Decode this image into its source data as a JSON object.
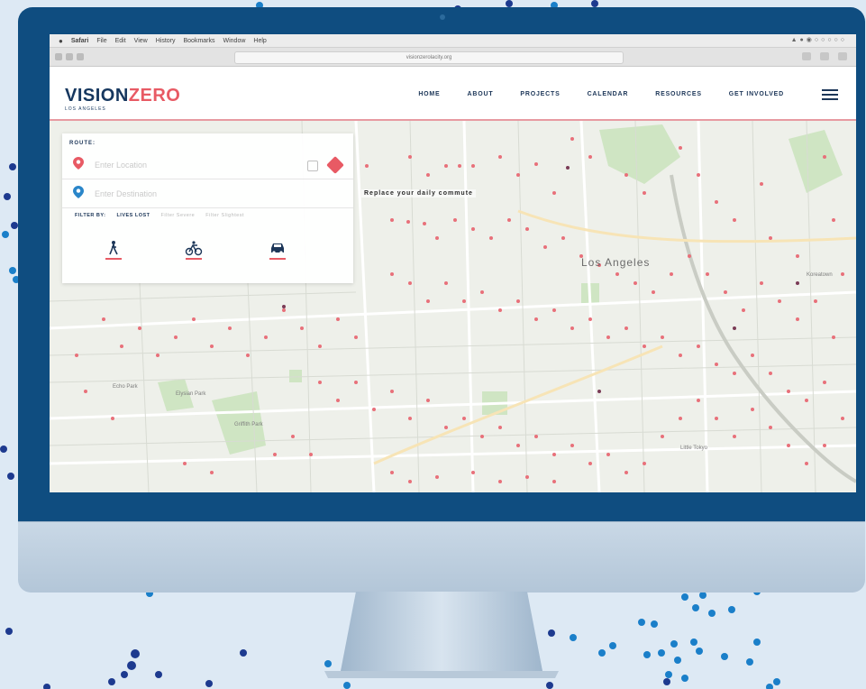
{
  "menubar": {
    "apple": "",
    "items": [
      "Safari",
      "File",
      "Edit",
      "View",
      "History",
      "Bookmarks",
      "Window",
      "Help"
    ]
  },
  "browser": {
    "url": "visionzerolacity.org"
  },
  "site": {
    "logo_vision": "VISION",
    "logo_zero": "ZERO",
    "logo_subtitle": "LOS ANGELES",
    "nav": [
      "HOME",
      "ABOUT",
      "PROJECTS",
      "CALENDAR",
      "RESOURCES",
      "GET INVOLVED"
    ],
    "accent_color": "#e85a64",
    "brand_color": "#16375f"
  },
  "route_panel": {
    "label": "ROUTE:",
    "start_placeholder": "Enter Location",
    "destination_placeholder": "Enter Destination",
    "filter_label": "FILTER BY:",
    "filters": [
      "LIVES LOST",
      "Filter Severe",
      "Filter Slightest"
    ],
    "mode_icons": [
      "pedestrian-icon",
      "bicycle-icon",
      "car-icon"
    ]
  },
  "map": {
    "commute_heading": "Replace your daily commute",
    "city_label": "Los Angeles",
    "places": [
      "Echo Park",
      "Elysian Park",
      "Griffith Park",
      "Little Tokyo",
      "Koreatown"
    ]
  }
}
